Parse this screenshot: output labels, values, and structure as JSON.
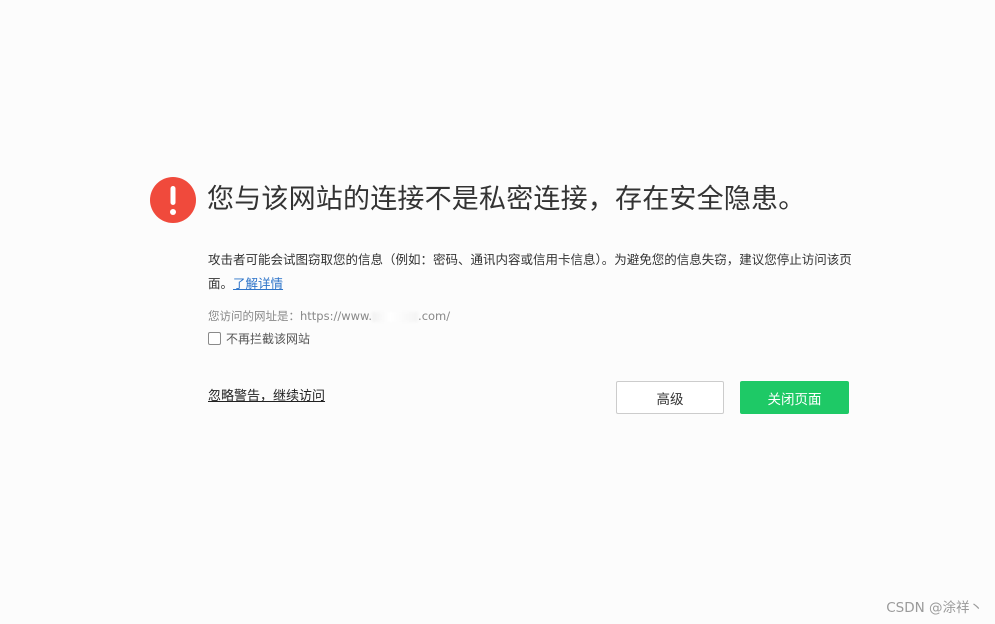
{
  "icon": "exclamation-icon",
  "colors": {
    "warning": "#f04a3c",
    "primary_button": "#1ec966",
    "link": "#2d74c9"
  },
  "title": "您与该网站的连接不是私密连接，存在安全隐患。",
  "description": {
    "text": "攻击者可能会试图窃取您的信息（例如：密码、通讯内容或信用卡信息）。为避免您的信息失窃，建议您停止访问该页面。",
    "learn_more": "了解详情"
  },
  "url_info": {
    "label": "您访问的网址是：",
    "url_prefix": "https://www.",
    "url_suffix": ".com/"
  },
  "checkbox": {
    "label": "不再拦截该网站",
    "checked": false
  },
  "actions": {
    "ignore_link": "忽略警告，继续访问",
    "advanced_button": "高级",
    "close_button": "关闭页面"
  },
  "watermark": "CSDN @涂祥丶"
}
